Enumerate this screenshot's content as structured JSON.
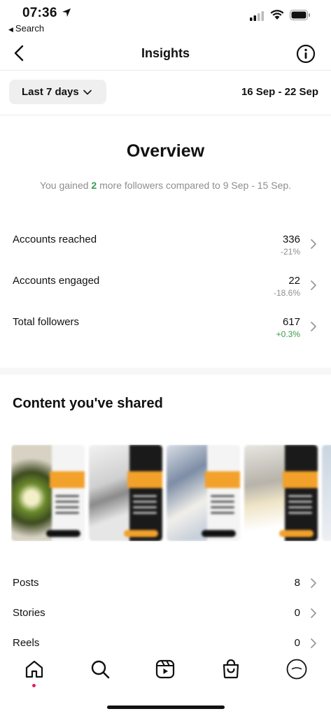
{
  "status": {
    "time": "07:36",
    "back_app": "Search"
  },
  "nav": {
    "title": "Insights"
  },
  "filter": {
    "range_label": "Last 7 days",
    "date_range": "16 Sep - 22 Sep"
  },
  "overview": {
    "title": "Overview",
    "subtitle_before": "You gained ",
    "subtitle_num": "2",
    "subtitle_after": " more followers compared to 9 Sep - 15 Sep.",
    "metrics": [
      {
        "label": "Accounts reached",
        "value": "336",
        "change": "-21%"
      },
      {
        "label": "Accounts engaged",
        "value": "22",
        "change": "-18.6%"
      },
      {
        "label": "Total followers",
        "value": "617",
        "change": "+0.3%"
      }
    ]
  },
  "content": {
    "title": "Content you've shared",
    "stats": [
      {
        "label": "Posts",
        "value": "8"
      },
      {
        "label": "Stories",
        "value": "0"
      },
      {
        "label": "Reels",
        "value": "0"
      }
    ]
  },
  "colors": {
    "positive": "#3a9b4c",
    "accent_orange": "#f2a12a",
    "notification_dot": "#e0245e"
  },
  "tabbar": {
    "items": [
      "home-icon",
      "search-icon",
      "reels-icon",
      "shop-icon",
      "profile-avatar"
    ]
  }
}
